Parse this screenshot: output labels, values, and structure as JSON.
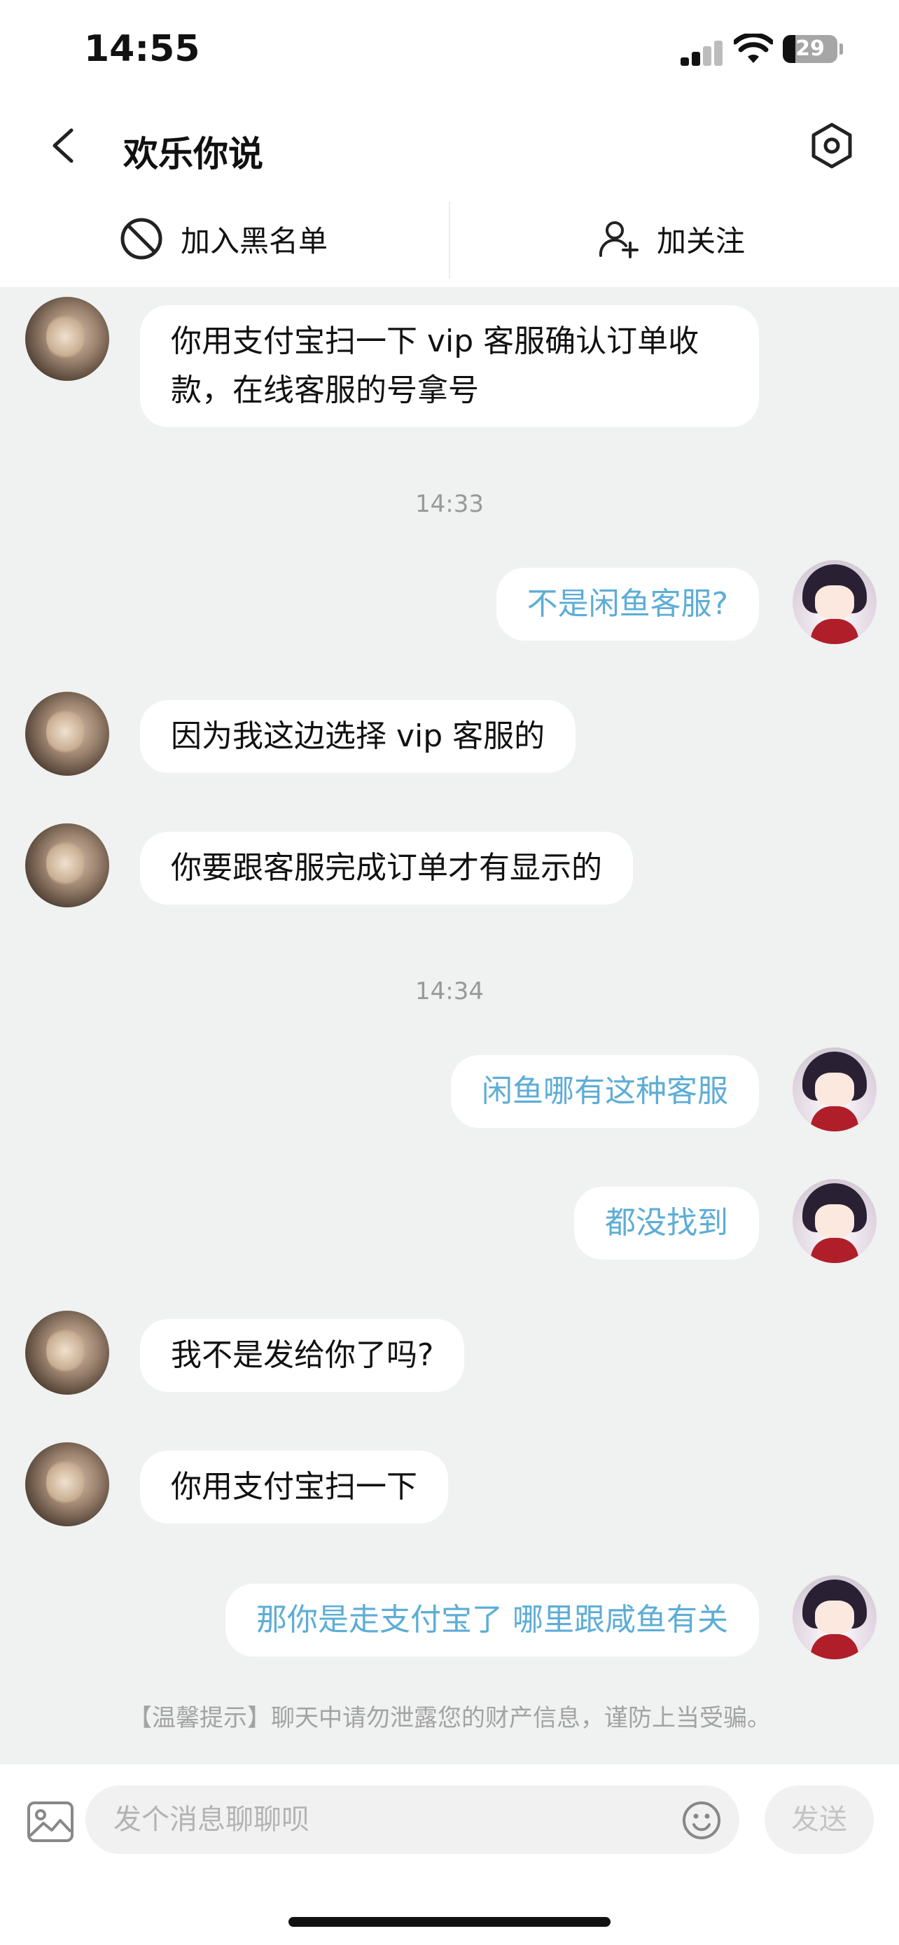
{
  "status_bar": {
    "time": "14:55",
    "battery": "29"
  },
  "nav": {
    "title": "欢乐你说",
    "back_icon": "chevron-left-icon",
    "settings_icon": "hexagon-gear-icon"
  },
  "actions": {
    "block_label": "加入黑名单",
    "follow_label": "加关注"
  },
  "messages": [
    {
      "from": "other",
      "text": "你用支付宝扫一下 vip 客服确认订单收款，在线客服的号拿号"
    },
    {
      "timestamp": "14:33"
    },
    {
      "from": "self",
      "text": "不是闲鱼客服?"
    },
    {
      "from": "other",
      "text": "因为我这边选择 vip 客服的"
    },
    {
      "from": "other",
      "text": "你要跟客服完成订单才有显示的"
    },
    {
      "timestamp": "14:34"
    },
    {
      "from": "self",
      "text": "闲鱼哪有这种客服"
    },
    {
      "from": "self",
      "text": "都没找到"
    },
    {
      "from": "other",
      "text": "我不是发给你了吗?"
    },
    {
      "from": "other",
      "text": "你用支付宝扫一下"
    },
    {
      "from": "self",
      "text": "那你是走支付宝了 哪里跟咸鱼有关"
    }
  ],
  "tip": "【温馨提示】聊天中请勿泄露您的财产信息，谨防上当受骗。",
  "input": {
    "placeholder": "发个消息聊聊呗",
    "send_label": "发送"
  },
  "colors": {
    "self_text": "#5dadd6",
    "chat_background": "#f0f1f1"
  }
}
